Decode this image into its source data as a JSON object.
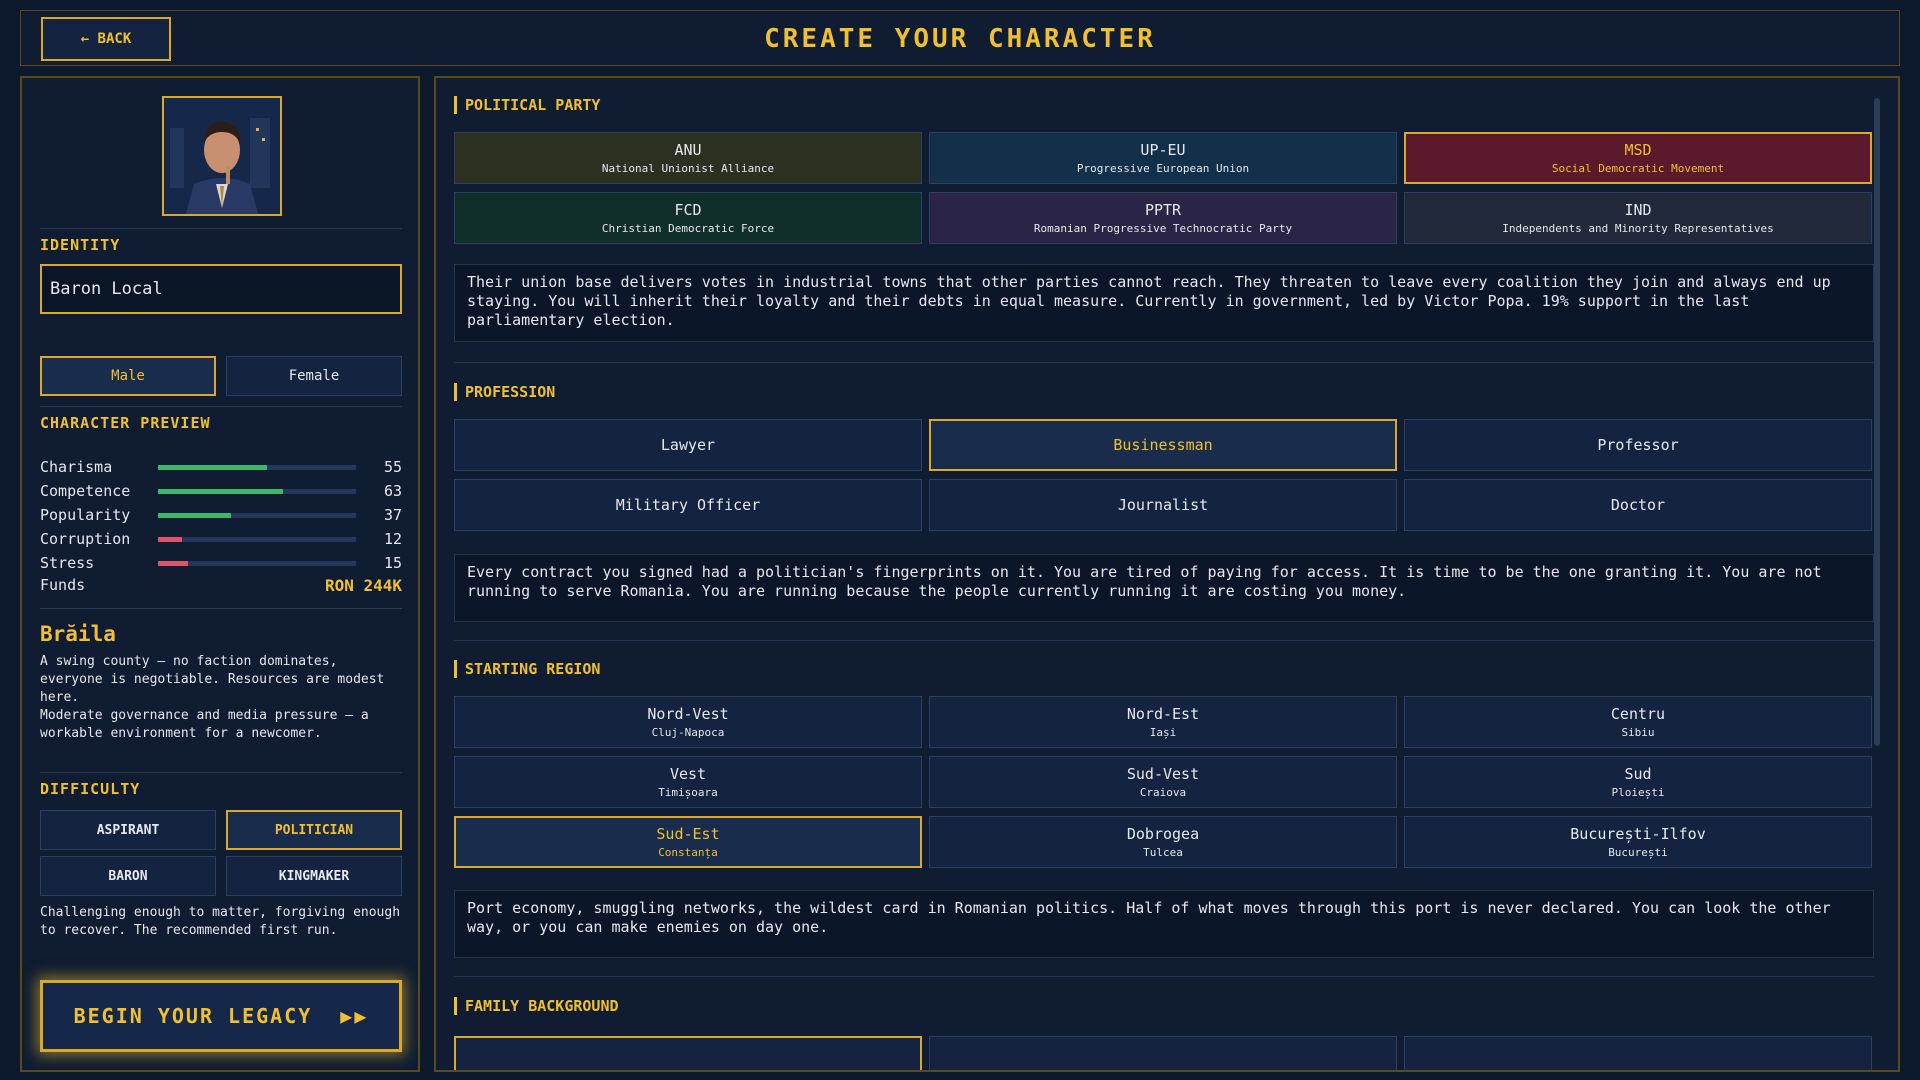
{
  "header": {
    "back_label": "← BACK",
    "title": "CREATE YOUR CHARACTER"
  },
  "left": {
    "identity_label": "IDENTITY",
    "name_value": "Baron Local",
    "gender": [
      "Male",
      "Female"
    ],
    "gender_selected": "Male",
    "preview_label": "CHARACTER PREVIEW",
    "stats": [
      {
        "name": "Charisma",
        "value": "55",
        "fill": 0.55,
        "color": "#3cb86a"
      },
      {
        "name": "Competence",
        "value": "63",
        "fill": 0.63,
        "color": "#3cb86a"
      },
      {
        "name": "Popularity",
        "value": "37",
        "fill": 0.37,
        "color": "#3cb86a"
      },
      {
        "name": "Corruption",
        "value": "12",
        "fill": 0.12,
        "color": "#d8556a"
      },
      {
        "name": "Stress",
        "value": "15",
        "fill": 0.15,
        "color": "#d8556a"
      }
    ],
    "funds_label": "Funds",
    "funds_value": "RON 244K",
    "county_name": "Brăila",
    "county_desc_1": "A swing county — no faction dominates, everyone is negotiable. Resources are modest here.",
    "county_desc_2": "Moderate governance and media pressure — a workable environment for a newcomer.",
    "difficulty_label": "DIFFICULTY",
    "difficulties": [
      "ASPIRANT",
      "POLITICIAN",
      "BARON",
      "KINGMAKER"
    ],
    "difficulty_selected": "POLITICIAN",
    "difficulty_desc": "Challenging enough to matter, forgiving enough to recover. The recommended first run.",
    "begin_label": "BEGIN YOUR LEGACY",
    "begin_icon": "▶▶"
  },
  "party": {
    "label": "POLITICAL PARTY",
    "options": [
      {
        "abbr": "ANU",
        "name": "National Unionist Alliance",
        "bg": "#2c3020"
      },
      {
        "abbr": "UP-EU",
        "name": "Progressive European Union",
        "bg": "#12304a"
      },
      {
        "abbr": "MSD",
        "name": "Social Democratic Movement",
        "bg": "#5a1a2c"
      },
      {
        "abbr": "FCD",
        "name": "Christian Democratic Force",
        "bg": "#102e2a"
      },
      {
        "abbr": "PPTR",
        "name": "Romanian Progressive Technocratic Party",
        "bg": "#2a2446"
      },
      {
        "abbr": "IND",
        "name": "Independents and Minority Representatives",
        "bg": "#22293a"
      }
    ],
    "selected": "MSD",
    "description": "Their union base delivers votes in industrial towns that other parties cannot reach. They threaten to leave every coalition they join and always end up staying. You will inherit their loyalty and their debts in equal measure. Currently in government, led by Victor Popa. 19% support in the last parliamentary election."
  },
  "profession": {
    "label": "PROFESSION",
    "options": [
      "Lawyer",
      "Businessman",
      "Professor",
      "Military Officer",
      "Journalist",
      "Doctor"
    ],
    "selected": "Businessman",
    "description": "Every contract you signed had a politician's fingerprints on it. You are tired of paying for access. It is time to be the one granting it. You are not running to serve Romania. You are running because the people currently running it are costing you money."
  },
  "region": {
    "label": "STARTING REGION",
    "options": [
      {
        "name": "Nord-Vest",
        "city": "Cluj-Napoca"
      },
      {
        "name": "Nord-Est",
        "city": "Iași"
      },
      {
        "name": "Centru",
        "city": "Sibiu"
      },
      {
        "name": "Vest",
        "city": "Timișoara"
      },
      {
        "name": "Sud-Vest",
        "city": "Craiova"
      },
      {
        "name": "Sud",
        "city": "Ploiești"
      },
      {
        "name": "Sud-Est",
        "city": "Constanța"
      },
      {
        "name": "Dobrogea",
        "city": "Tulcea"
      },
      {
        "name": "București-Ilfov",
        "city": "București"
      }
    ],
    "selected": "Sud-Est",
    "description": "Port economy, smuggling networks, the wildest card in Romanian politics. Half of what moves through this port is never declared. You can look the other way, or you can make enemies on day one."
  },
  "family": {
    "label": "FAMILY BACKGROUND"
  }
}
